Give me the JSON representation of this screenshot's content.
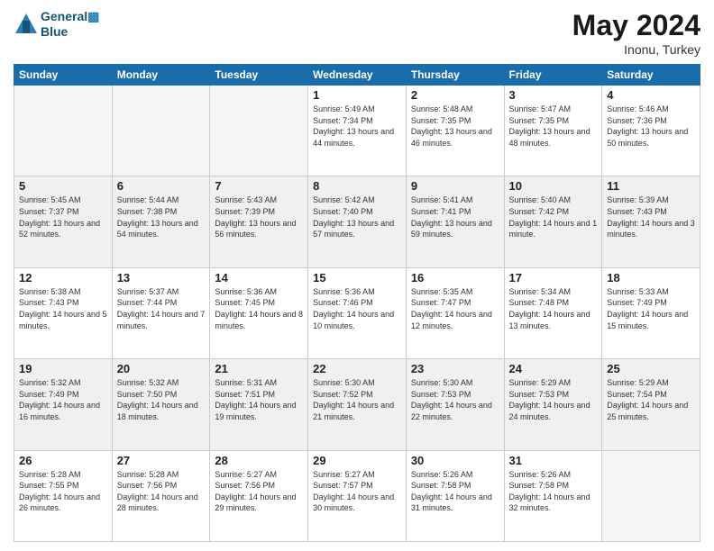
{
  "header": {
    "logo_line1": "General",
    "logo_line2": "Blue",
    "month": "May 2024",
    "location": "Inonu, Turkey"
  },
  "weekdays": [
    "Sunday",
    "Monday",
    "Tuesday",
    "Wednesday",
    "Thursday",
    "Friday",
    "Saturday"
  ],
  "weeks": [
    [
      {
        "day": "",
        "empty": true
      },
      {
        "day": "",
        "empty": true
      },
      {
        "day": "",
        "empty": true
      },
      {
        "day": "1",
        "sunrise": "Sunrise: 5:49 AM",
        "sunset": "Sunset: 7:34 PM",
        "daylight": "Daylight: 13 hours and 44 minutes."
      },
      {
        "day": "2",
        "sunrise": "Sunrise: 5:48 AM",
        "sunset": "Sunset: 7:35 PM",
        "daylight": "Daylight: 13 hours and 46 minutes."
      },
      {
        "day": "3",
        "sunrise": "Sunrise: 5:47 AM",
        "sunset": "Sunset: 7:35 PM",
        "daylight": "Daylight: 13 hours and 48 minutes."
      },
      {
        "day": "4",
        "sunrise": "Sunrise: 5:46 AM",
        "sunset": "Sunset: 7:36 PM",
        "daylight": "Daylight: 13 hours and 50 minutes."
      }
    ],
    [
      {
        "day": "5",
        "sunrise": "Sunrise: 5:45 AM",
        "sunset": "Sunset: 7:37 PM",
        "daylight": "Daylight: 13 hours and 52 minutes."
      },
      {
        "day": "6",
        "sunrise": "Sunrise: 5:44 AM",
        "sunset": "Sunset: 7:38 PM",
        "daylight": "Daylight: 13 hours and 54 minutes."
      },
      {
        "day": "7",
        "sunrise": "Sunrise: 5:43 AM",
        "sunset": "Sunset: 7:39 PM",
        "daylight": "Daylight: 13 hours and 56 minutes."
      },
      {
        "day": "8",
        "sunrise": "Sunrise: 5:42 AM",
        "sunset": "Sunset: 7:40 PM",
        "daylight": "Daylight: 13 hours and 57 minutes."
      },
      {
        "day": "9",
        "sunrise": "Sunrise: 5:41 AM",
        "sunset": "Sunset: 7:41 PM",
        "daylight": "Daylight: 13 hours and 59 minutes."
      },
      {
        "day": "10",
        "sunrise": "Sunrise: 5:40 AM",
        "sunset": "Sunset: 7:42 PM",
        "daylight": "Daylight: 14 hours and 1 minute."
      },
      {
        "day": "11",
        "sunrise": "Sunrise: 5:39 AM",
        "sunset": "Sunset: 7:43 PM",
        "daylight": "Daylight: 14 hours and 3 minutes."
      }
    ],
    [
      {
        "day": "12",
        "sunrise": "Sunrise: 5:38 AM",
        "sunset": "Sunset: 7:43 PM",
        "daylight": "Daylight: 14 hours and 5 minutes."
      },
      {
        "day": "13",
        "sunrise": "Sunrise: 5:37 AM",
        "sunset": "Sunset: 7:44 PM",
        "daylight": "Daylight: 14 hours and 7 minutes."
      },
      {
        "day": "14",
        "sunrise": "Sunrise: 5:36 AM",
        "sunset": "Sunset: 7:45 PM",
        "daylight": "Daylight: 14 hours and 8 minutes."
      },
      {
        "day": "15",
        "sunrise": "Sunrise: 5:36 AM",
        "sunset": "Sunset: 7:46 PM",
        "daylight": "Daylight: 14 hours and 10 minutes."
      },
      {
        "day": "16",
        "sunrise": "Sunrise: 5:35 AM",
        "sunset": "Sunset: 7:47 PM",
        "daylight": "Daylight: 14 hours and 12 minutes."
      },
      {
        "day": "17",
        "sunrise": "Sunrise: 5:34 AM",
        "sunset": "Sunset: 7:48 PM",
        "daylight": "Daylight: 14 hours and 13 minutes."
      },
      {
        "day": "18",
        "sunrise": "Sunrise: 5:33 AM",
        "sunset": "Sunset: 7:49 PM",
        "daylight": "Daylight: 14 hours and 15 minutes."
      }
    ],
    [
      {
        "day": "19",
        "sunrise": "Sunrise: 5:32 AM",
        "sunset": "Sunset: 7:49 PM",
        "daylight": "Daylight: 14 hours and 16 minutes."
      },
      {
        "day": "20",
        "sunrise": "Sunrise: 5:32 AM",
        "sunset": "Sunset: 7:50 PM",
        "daylight": "Daylight: 14 hours and 18 minutes."
      },
      {
        "day": "21",
        "sunrise": "Sunrise: 5:31 AM",
        "sunset": "Sunset: 7:51 PM",
        "daylight": "Daylight: 14 hours and 19 minutes."
      },
      {
        "day": "22",
        "sunrise": "Sunrise: 5:30 AM",
        "sunset": "Sunset: 7:52 PM",
        "daylight": "Daylight: 14 hours and 21 minutes."
      },
      {
        "day": "23",
        "sunrise": "Sunrise: 5:30 AM",
        "sunset": "Sunset: 7:53 PM",
        "daylight": "Daylight: 14 hours and 22 minutes."
      },
      {
        "day": "24",
        "sunrise": "Sunrise: 5:29 AM",
        "sunset": "Sunset: 7:53 PM",
        "daylight": "Daylight: 14 hours and 24 minutes."
      },
      {
        "day": "25",
        "sunrise": "Sunrise: 5:29 AM",
        "sunset": "Sunset: 7:54 PM",
        "daylight": "Daylight: 14 hours and 25 minutes."
      }
    ],
    [
      {
        "day": "26",
        "sunrise": "Sunrise: 5:28 AM",
        "sunset": "Sunset: 7:55 PM",
        "daylight": "Daylight: 14 hours and 26 minutes."
      },
      {
        "day": "27",
        "sunrise": "Sunrise: 5:28 AM",
        "sunset": "Sunset: 7:56 PM",
        "daylight": "Daylight: 14 hours and 28 minutes."
      },
      {
        "day": "28",
        "sunrise": "Sunrise: 5:27 AM",
        "sunset": "Sunset: 7:56 PM",
        "daylight": "Daylight: 14 hours and 29 minutes."
      },
      {
        "day": "29",
        "sunrise": "Sunrise: 5:27 AM",
        "sunset": "Sunset: 7:57 PM",
        "daylight": "Daylight: 14 hours and 30 minutes."
      },
      {
        "day": "30",
        "sunrise": "Sunrise: 5:26 AM",
        "sunset": "Sunset: 7:58 PM",
        "daylight": "Daylight: 14 hours and 31 minutes."
      },
      {
        "day": "31",
        "sunrise": "Sunrise: 5:26 AM",
        "sunset": "Sunset: 7:58 PM",
        "daylight": "Daylight: 14 hours and 32 minutes."
      },
      {
        "day": "",
        "empty": true
      }
    ]
  ]
}
